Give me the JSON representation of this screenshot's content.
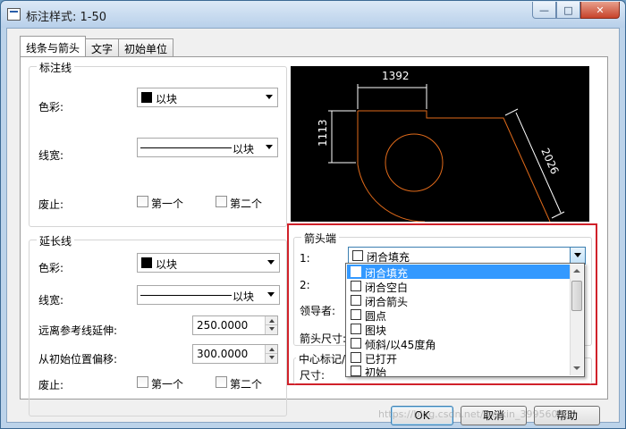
{
  "window": {
    "title": "标注样式: 1-50"
  },
  "tabs": [
    {
      "label": "线条与箭头",
      "active": true
    },
    {
      "label": "文字",
      "active": false
    },
    {
      "label": "初始单位",
      "active": false
    }
  ],
  "dimension_line": {
    "legend": "标注线",
    "color_label": "色彩:",
    "color_value": "以块",
    "lineweight_label": "线宽:",
    "lineweight_value": "以块",
    "suppress_label": "废止:",
    "suppress_first": "第一个",
    "suppress_second": "第二个"
  },
  "extension_line": {
    "legend": "延长线",
    "color_label": "色彩:",
    "color_value": "以块",
    "lineweight_label": "线宽:",
    "lineweight_value": "以块",
    "extend_label": "远离参考线延伸:",
    "extend_value": "250.0000",
    "offset_label": "从初始位置偏移:",
    "offset_value": "300.0000",
    "suppress_label": "废止:",
    "suppress_first": "第一个",
    "suppress_second": "第二个"
  },
  "preview": {
    "dim_top": "1392",
    "dim_left": "1113",
    "dim_right": "2026",
    "line_color": "#e06a1a",
    "dim_color": "#ffffff"
  },
  "arrowheads": {
    "legend": "箭头端",
    "first_label": "1:",
    "first_value": "闭合填充",
    "second_label": "2:",
    "leader_label": "领导者:",
    "size_label": "箭头尺寸:"
  },
  "center_marks": {
    "legend": "中心标记/线",
    "size_label": "尺寸:"
  },
  "arrow_dropdown": {
    "options": [
      {
        "label": "闭合填充",
        "icon": "closed-filled-arrow-icon",
        "selected": true
      },
      {
        "label": "闭合空白",
        "icon": "closed-blank-arrow-icon",
        "selected": false
      },
      {
        "label": "闭合箭头",
        "icon": "closed-arrow-icon",
        "selected": false
      },
      {
        "label": "圆点",
        "icon": "dot-icon",
        "selected": false
      },
      {
        "label": "图块",
        "icon": "block-icon",
        "selected": false
      },
      {
        "label": "倾斜/以45度角",
        "icon": "oblique-icon",
        "selected": false
      },
      {
        "label": "已打开",
        "icon": "open-arrow-icon",
        "selected": false
      },
      {
        "label": "初始",
        "icon": "origin-icon",
        "selected": false
      }
    ]
  },
  "buttons": {
    "ok": "OK",
    "cancel": "取消",
    "help": "帮助"
  },
  "watermark": "https://blog.csdn.net/weixin_39956066",
  "colors": {
    "highlight_border": "#d0212a",
    "selection": "#3399ff"
  }
}
